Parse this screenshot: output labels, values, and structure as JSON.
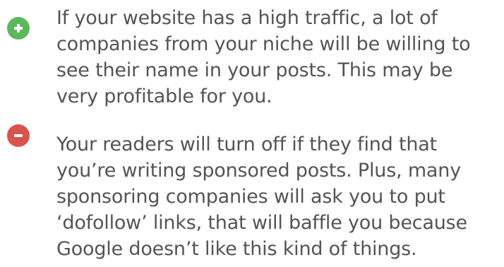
{
  "pros_cons": {
    "pro": {
      "icon": "plus-icon",
      "color": "#5cb85c",
      "text": "If your website has a high traffic, a lot of companies from your niche will be willing to see their name in your posts. This may be very profitable for you."
    },
    "con": {
      "icon": "minus-icon",
      "color": "#d9534f",
      "text": "Your readers will turn off if they find that you’re writing sponsored posts. Plus, many sponsoring companies will ask you to put ‘dofollow’ links, that will baffle you because Google doesn’t like this kind of things."
    }
  }
}
